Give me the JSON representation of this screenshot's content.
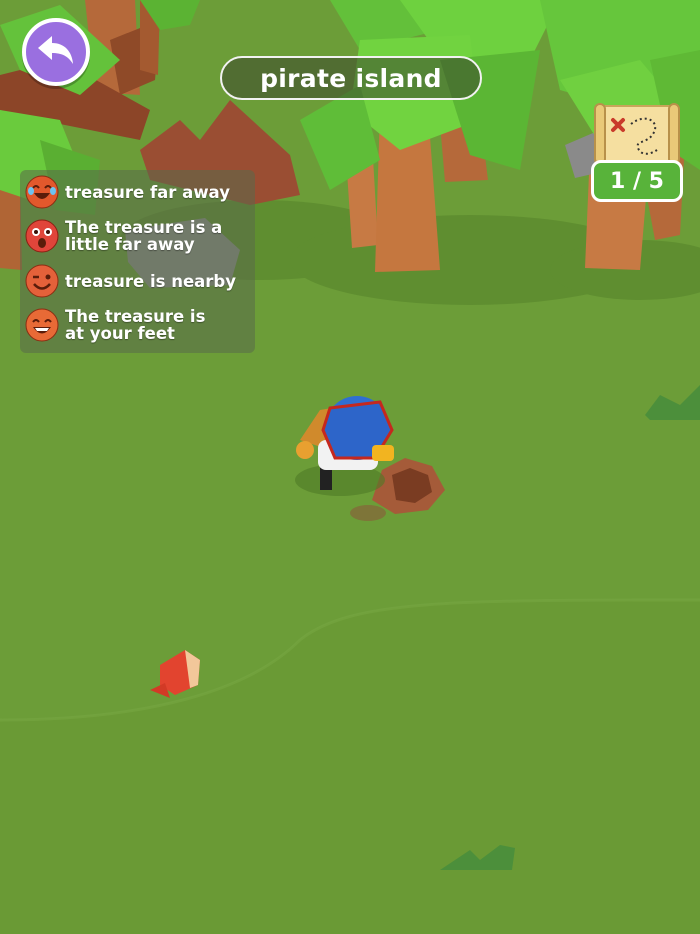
{
  "header": {
    "title": "pirate island"
  },
  "legend": {
    "items": [
      {
        "label_line1": "treasure far away",
        "label_line2": "",
        "face_icon": "crying-laughing-face-icon",
        "face_color": "#e2582c"
      },
      {
        "label_line1": "The treasure is a",
        "label_line2": "little far away",
        "face_icon": "surprised-face-icon",
        "face_color": "#e0453a"
      },
      {
        "label_line1": "treasure is nearby",
        "label_line2": "",
        "face_icon": "winking-face-icon",
        "face_color": "#e4613a"
      },
      {
        "label_line1": "The treasure is",
        "label_line2": "at your feet",
        "face_icon": "grinning-face-icon",
        "face_color": "#e86a36"
      }
    ]
  },
  "map_progress": {
    "counter": "1 / 5",
    "found": 1,
    "total": 5,
    "icon": "treasure-map-icon"
  },
  "colors": {
    "grass": "#6f9f3a",
    "back_button": "#9a6fe0",
    "counter_green": "#58b33a"
  }
}
